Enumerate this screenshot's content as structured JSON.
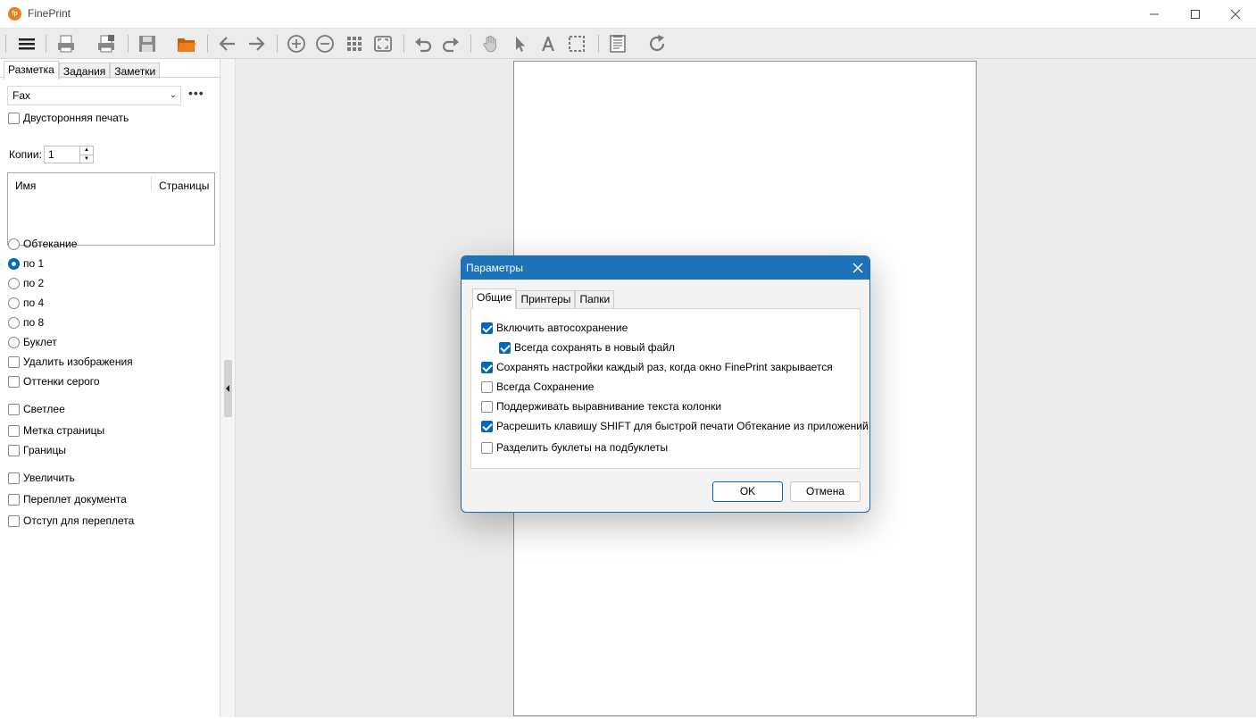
{
  "window": {
    "title": "FinePrint",
    "icon_label": "fp"
  },
  "toolbar": {
    "icons": [
      "menu-icon",
      "print-icon",
      "print-properties-icon",
      "save-icon",
      "open-folder-icon",
      "back-arrow-icon",
      "forward-arrow-icon",
      "zoom-in-icon",
      "zoom-out-icon",
      "thumbnails-grid-icon",
      "fit-page-icon",
      "undo-icon",
      "redo-icon",
      "hand-icon",
      "pointer-icon",
      "text-icon",
      "select-rect-icon",
      "notes-icon",
      "refresh-icon"
    ]
  },
  "left_panel": {
    "tabs": [
      {
        "label": "Разметка",
        "active": true
      },
      {
        "label": "Задания",
        "active": false
      },
      {
        "label": "Заметки",
        "active": false
      }
    ],
    "printer_select": "Fax",
    "more_button": "•••",
    "duplex_label": "Двусторонняя печать",
    "copies_label": "Копии:",
    "copies_value": "1",
    "list_headers": {
      "name": "Имя",
      "pages": "Страницы"
    },
    "layout_options": [
      {
        "label": "Обтекание",
        "selected": false
      },
      {
        "label": "по 1",
        "selected": true
      },
      {
        "label": "по 2",
        "selected": false
      },
      {
        "label": "по 4",
        "selected": false
      },
      {
        "label": "по 8",
        "selected": false
      },
      {
        "label": "Буклет",
        "selected": false
      }
    ],
    "checkboxes_a": [
      "Удалить изображения",
      "Оттенки серого"
    ],
    "checkboxes_b": [
      "Светлее",
      "Метка страницы",
      "Границы"
    ],
    "checkboxes_c": [
      "Увеличить",
      "Переплет документа",
      "Отступ для переплета"
    ]
  },
  "dialog": {
    "title": "Параметры",
    "tabs": [
      {
        "label": "Общие",
        "active": true
      },
      {
        "label": "Принтеры",
        "active": false
      },
      {
        "label": "Папки",
        "active": false
      }
    ],
    "options": [
      {
        "label": "Включить автосохранение",
        "checked": true,
        "indent": false
      },
      {
        "label": "Всегда сохранять в новый файл",
        "checked": true,
        "indent": true
      },
      {
        "label": "Сохранять настройки каждый раз, когда окно FinePrint закрывается",
        "checked": true,
        "indent": false
      },
      {
        "label": "Всегда Сохранение",
        "checked": false,
        "indent": false
      },
      {
        "label": "Поддерживать выравнивание текста колонки",
        "checked": false,
        "indent": false
      },
      {
        "label": "Расрешить клавишу SHIFT для быстрой печати Обтекание из приложений",
        "checked": true,
        "indent": false
      },
      {
        "label": "Разделить буклеты на подбуклеты",
        "checked": false,
        "indent": false
      }
    ],
    "ok_label": "OK",
    "cancel_label": "Отмена"
  },
  "colors": {
    "accent": "#0067c0",
    "dialog_title_bar": "#1e72b8",
    "folder_icon": "#f07c1a"
  }
}
